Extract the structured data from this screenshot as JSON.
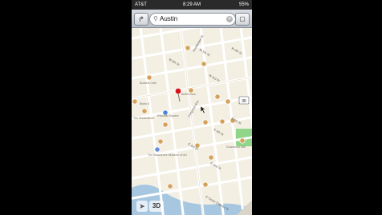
{
  "status_bar": {
    "carrier": "AT&T",
    "time": "8:29 AM",
    "battery": "55%"
  },
  "search": {
    "value": "Austin"
  },
  "map": {
    "place_labels": [
      "Buddha Cafe",
      "Buffet Bros",
      "Bistro 5",
      "Republic Square",
      "The Brownstone",
      "The Bioscience Museum of Art",
      "Downtown Hall"
    ],
    "street_labels": [
      "W 6th St",
      "W 5th St",
      "W 4th St",
      "W 3rd St",
      "E 5th St",
      "E 4th St",
      "E 3rd St",
      "E 2nd St",
      "Congress Ave",
      "Guadalupe St",
      "E Cesar Chavez St"
    ],
    "highway_shield": "35",
    "water_color": "#a7c6e0",
    "park_color": "#8fd58a",
    "pin_color": "#d8101b"
  },
  "controls": {
    "three_d_label": "3D"
  }
}
